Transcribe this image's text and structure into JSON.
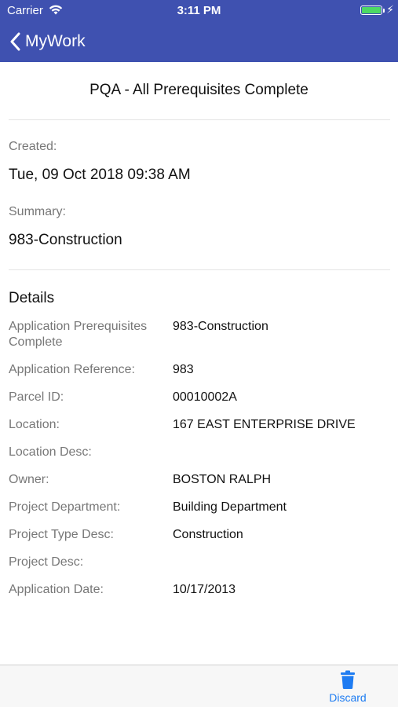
{
  "status_bar": {
    "carrier": "Carrier",
    "time": "3:11 PM"
  },
  "nav": {
    "back_label": "MyWork"
  },
  "record": {
    "title": "PQA - All Prerequisites Complete",
    "created_label": "Created:",
    "created_value": "Tue, 09 Oct 2018 09:38 AM",
    "summary_label": "Summary:",
    "summary_value": "983-Construction"
  },
  "details": {
    "heading": "Details",
    "rows": [
      {
        "label": "Application Prerequisites Complete",
        "value": "983-Construction"
      },
      {
        "label": "Application Reference:",
        "value": "983"
      },
      {
        "label": "Parcel ID:",
        "value": "00010002A"
      },
      {
        "label": "Location:",
        "value": "167 EAST ENTERPRISE DRIVE"
      },
      {
        "label": "Location Desc:",
        "value": ""
      },
      {
        "label": "Owner:",
        "value": "BOSTON RALPH"
      },
      {
        "label": "Project Department:",
        "value": "Building Department"
      },
      {
        "label": "Project Type Desc:",
        "value": "Construction"
      },
      {
        "label": "Project Desc:",
        "value": ""
      },
      {
        "label": "Application Date:",
        "value": "10/17/2013"
      }
    ]
  },
  "toolbar": {
    "discard_label": "Discard"
  },
  "colors": {
    "nav_bar": "#3f51b0",
    "accent": "#1e7cf2",
    "battery": "#4cd964"
  }
}
